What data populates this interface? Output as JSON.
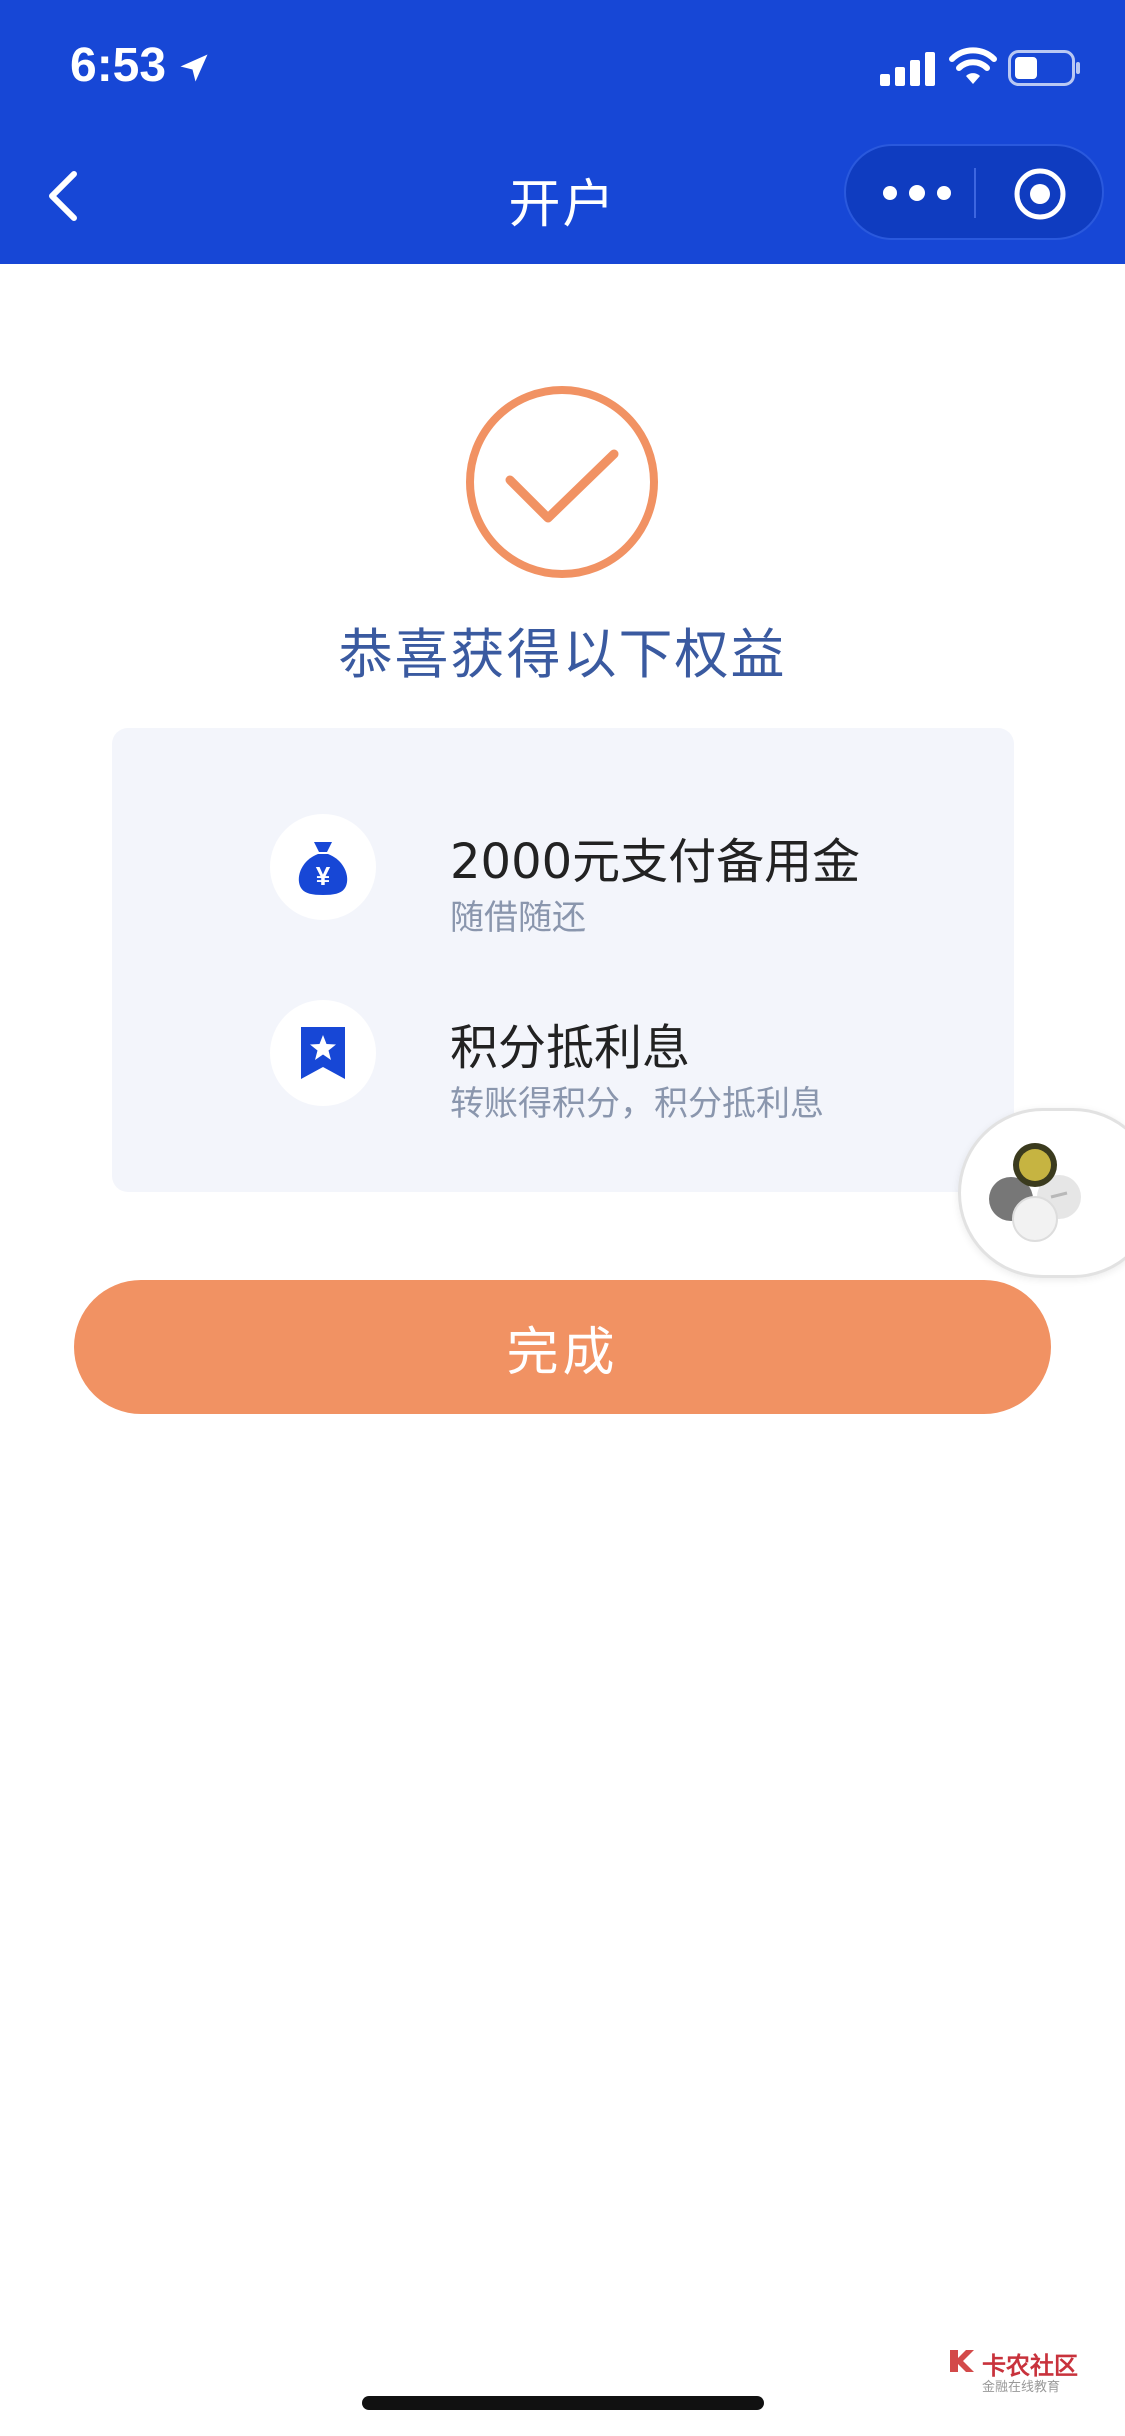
{
  "status_bar": {
    "time": "6:53"
  },
  "nav": {
    "title": "开户"
  },
  "result": {
    "headline": "恭喜获得以下权益"
  },
  "benefits": [
    {
      "icon": "money-bag-yen-icon",
      "title": "2000元支付备用金",
      "desc": "随借随还"
    },
    {
      "icon": "bookmark-star-icon",
      "title": "积分抵利息",
      "desc": "转账得积分，积分抵利息"
    }
  ],
  "actions": {
    "done_label": "完成"
  },
  "watermark": {
    "title": "卡农社区",
    "subtitle": "金融在线教育"
  },
  "colors": {
    "header": "#1747d6",
    "accent": "#f19263",
    "headline": "#3a5aa0",
    "icon_blue": "#1747d6"
  }
}
